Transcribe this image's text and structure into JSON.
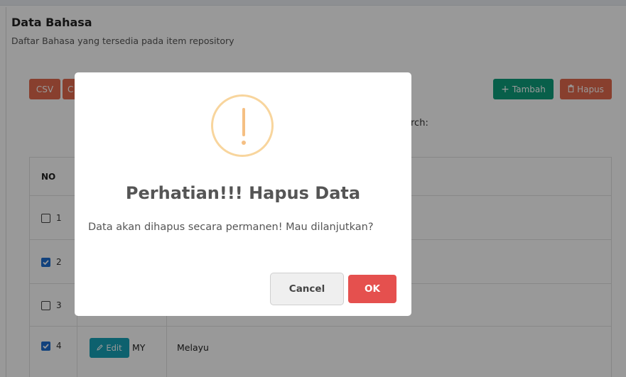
{
  "page": {
    "title": "Data Bahasa",
    "subtitle": "Daftar Bahasa yang tersedia pada item repository"
  },
  "toolbar": {
    "csv_label": "CSV",
    "copy_label": "C",
    "tambah_label": "Tambah",
    "hapus_label": "Hapus",
    "search_label": "rch:"
  },
  "table": {
    "header_no": "NO",
    "rows": [
      {
        "no": "1",
        "checked": false
      },
      {
        "no": "2",
        "checked": true
      },
      {
        "no": "3",
        "checked": false
      },
      {
        "no": "4",
        "checked": true,
        "edit_label": "Edit",
        "kode": "MY",
        "bahasa": "Melayu"
      }
    ]
  },
  "modal": {
    "title": "Perhatian!!! Hapus Data",
    "message": "Data akan dihapus secara permanen! Mau dilanjutkan?",
    "cancel_label": "Cancel",
    "ok_label": "OK"
  },
  "colors": {
    "danger": "#e36a4d",
    "success": "#0e9f7c",
    "info": "#17a2b8",
    "ok_button": "#e5504e",
    "warning_icon": "#f8d59d"
  },
  "icons": {
    "tambah": "plus-icon",
    "hapus": "trash-icon",
    "edit": "pencil-icon",
    "modal": "warning-icon"
  }
}
